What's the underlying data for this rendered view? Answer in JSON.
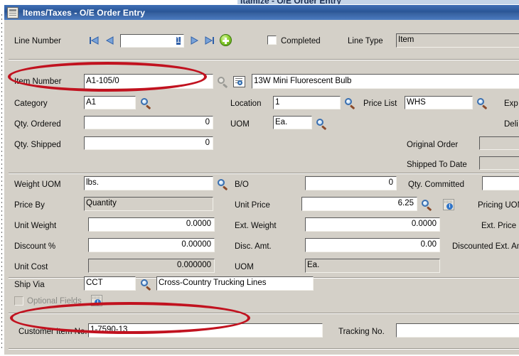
{
  "background_window": {
    "title_fragment": "Itamize - O/E Order Entry"
  },
  "window": {
    "title": "Items/Taxes - O/E Order Entry",
    "icon": "window-document-icon"
  },
  "toolbar": {
    "line_number_label": "Line Number",
    "line_number_value": "1",
    "first_icon": "nav-first-icon",
    "prev_icon": "nav-prev-icon",
    "next_icon": "nav-next-icon",
    "last_icon": "nav-last-icon",
    "new_icon": "nav-new-plus-icon",
    "completed_label": "Completed",
    "completed_checked": false,
    "line_type_label": "Line Type",
    "line_type_value": "Item"
  },
  "fields": {
    "item_number": {
      "label": "Item Number",
      "value": "A1-105/0",
      "finder_icon": "magnifier-icon",
      "drill_icon": "document-magnifier-icon"
    },
    "item_description": {
      "value": "13W Mini Fluorescent Bulb"
    },
    "category": {
      "label": "Category",
      "value": "A1",
      "finder_icon": "magnifier-icon"
    },
    "location": {
      "label": "Location",
      "value": "1",
      "finder_icon": "magnifier-icon"
    },
    "price_list": {
      "label": "Price List",
      "value": "WHS",
      "finder_icon": "magnifier-icon"
    },
    "expected": {
      "label": "Exp"
    },
    "delivery": {
      "label": "Deli"
    },
    "qty_ordered": {
      "label": "Qty. Ordered",
      "value": "0"
    },
    "qty_shipped": {
      "label": "Qty. Shipped",
      "value": "0"
    },
    "uom_top": {
      "label": "UOM",
      "value": "Ea.",
      "finder_icon": "magnifier-icon"
    },
    "original_order": {
      "label": "Original Order",
      "value": ""
    },
    "shipped_to_date": {
      "label": "Shipped To Date",
      "value": ""
    },
    "qty_committed": {
      "label": "Qty. Committed",
      "value": ""
    },
    "weight_uom": {
      "label": "Weight UOM",
      "value": "lbs.",
      "finder_icon": "magnifier-icon"
    },
    "bo": {
      "label": "B/O",
      "value": "0"
    },
    "price_by": {
      "label": "Price By",
      "value": "Quantity"
    },
    "unit_price": {
      "label": "Unit Price",
      "value": "6.25",
      "finder_icon": "magnifier-icon",
      "info_icon": "info-drilldown-icon"
    },
    "pricing_uom": {
      "label": "Pricing UOM"
    },
    "unit_weight": {
      "label": "Unit Weight",
      "value": "0.0000"
    },
    "ext_weight": {
      "label": "Ext. Weight",
      "value": "0.0000"
    },
    "ext_price": {
      "label": "Ext. Price"
    },
    "discount_pct": {
      "label": "Discount %",
      "value": "0.00000"
    },
    "disc_amt": {
      "label": "Disc. Amt.",
      "value": "0.00"
    },
    "discounted_ext_amt": {
      "label": "Discounted Ext. Amt"
    },
    "unit_cost": {
      "label": "Unit Cost",
      "value": "0.000000"
    },
    "uom_bottom": {
      "label": "UOM",
      "value": "Ea."
    },
    "ship_via": {
      "label": "Ship Via",
      "code": "CCT",
      "description": "Cross-Country Trucking Lines",
      "finder_icon": "magnifier-icon"
    },
    "optional_fields": {
      "label": "Optional Fields",
      "checked": false,
      "info_icon": "info-drilldown-icon"
    },
    "customer_item_no": {
      "label": "Customer Item No.",
      "value": "1-7590-13"
    },
    "tracking_no": {
      "label": "Tracking No.",
      "value": ""
    }
  },
  "annotations": {
    "ellipse_color": "#c1121f",
    "highlights": [
      "item-number-row",
      "customer-item-no-row"
    ]
  }
}
